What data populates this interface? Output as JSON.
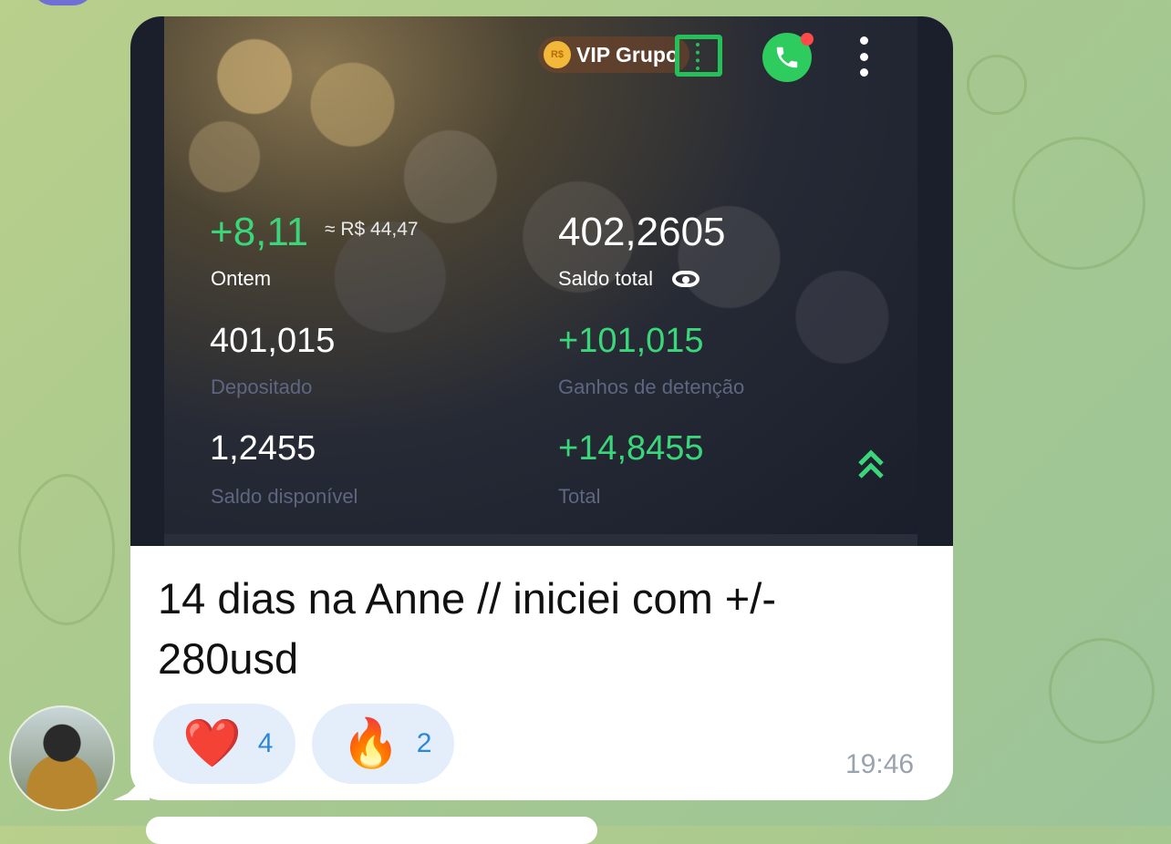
{
  "media": {
    "vip_coin_label": "R$",
    "vip_label": "VIP Grupo",
    "yesterday_gain": "+8,11",
    "yesterday_approx": "≈ R$ 44,47",
    "yesterday_label": "Ontem",
    "total_balance": "402,2605",
    "total_balance_label": "Saldo total",
    "deposited": "401,015",
    "deposited_label": "Depositado",
    "holding_gains": "+101,015",
    "holding_gains_label": "Ganhos de detenção",
    "available": "1,2455",
    "available_label": "Saldo disponível",
    "total": "+14,8455",
    "total_label": "Total"
  },
  "message": {
    "text": "14 dias na Anne // iniciei com +/- 280usd",
    "time": "19:46"
  },
  "reactions": [
    {
      "emoji": "❤️",
      "count": "4"
    },
    {
      "emoji": "🔥",
      "count": "2"
    }
  ],
  "colors": {
    "accent_green": "#3cd67a",
    "reaction_blue": "#2b88d8"
  }
}
